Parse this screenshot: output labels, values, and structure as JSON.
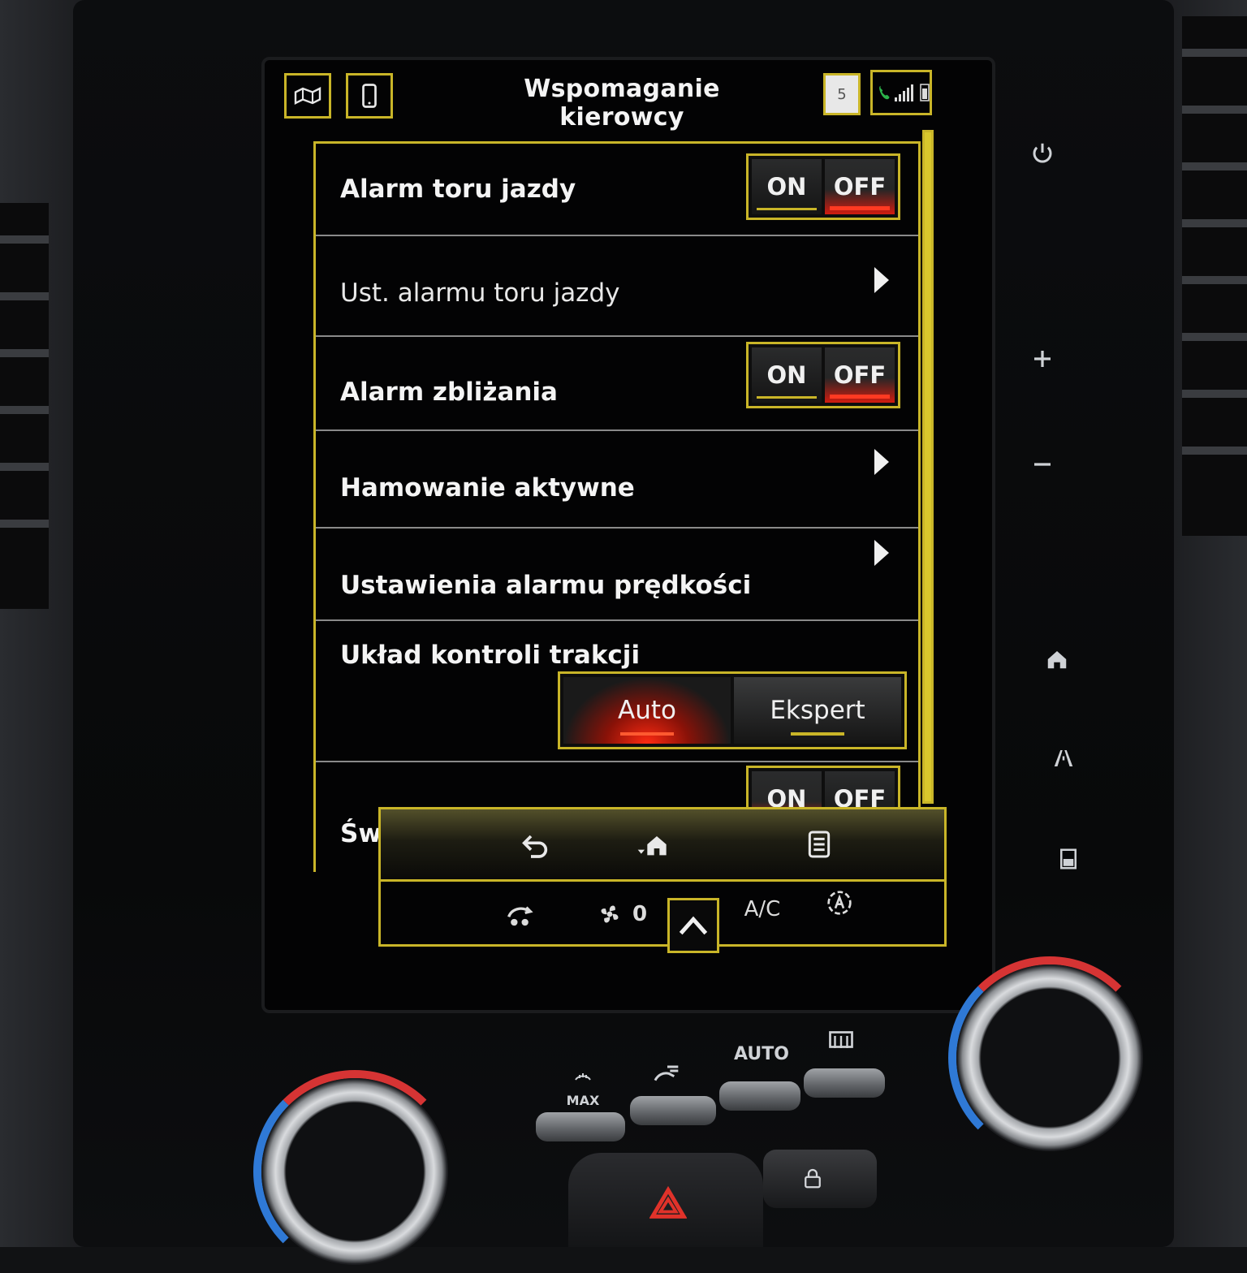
{
  "header": {
    "title": "Wspomaganie kierowcy",
    "notification_count": "5",
    "icons": [
      "map-icon",
      "phone-device-icon",
      "notification-icon",
      "phone-call-icon",
      "signal-bars-icon",
      "battery-icon"
    ]
  },
  "settings": {
    "lane_alarm": {
      "label": "Alarm toru jazdy",
      "on_label": "ON",
      "off_label": "OFF",
      "selected": "OFF"
    },
    "lane_alarm_settings": {
      "label": "Ust. alarmu toru jazdy"
    },
    "approach_alarm": {
      "label": "Alarm zbliżania",
      "on_label": "ON",
      "off_label": "OFF",
      "selected": "OFF"
    },
    "active_braking": {
      "label": "Hamowanie aktywne"
    },
    "speed_alarm_settings": {
      "label": "Ustawienia alarmu prędkości"
    },
    "traction_control": {
      "label": "Układ kontroli trakcji",
      "option_auto": "Auto",
      "option_expert": "Ekspert",
      "selected": "Auto"
    },
    "auto_lights": {
      "label": "Światła autom.",
      "on_label": "ON",
      "off_label": "OFF",
      "selected": "ON"
    }
  },
  "climate": {
    "fan_level": "0",
    "ac_label": "A/C"
  },
  "physical_panel": {
    "defrost_label": "MAX",
    "auto_label": "AUTO"
  },
  "colors": {
    "accent": "#c9b528",
    "active": "#d21c10",
    "knob_cold": "#2f79d6",
    "knob_hot": "#d63434"
  }
}
